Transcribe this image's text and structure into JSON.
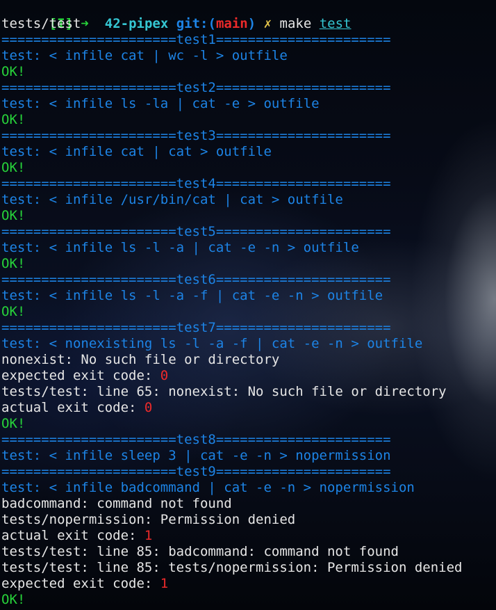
{
  "prompt": {
    "indicator": "[I]",
    "arrow": "➜",
    "directory": "42-pipex",
    "git_prefix": "git:(",
    "branch": "main",
    "git_suffix": ")",
    "dirty_mark": "✗",
    "command": "make",
    "target": "test"
  },
  "output": [
    {
      "text": "tests/test",
      "color": "white"
    },
    {
      "text": "======================test1======================",
      "color": "blue"
    },
    {
      "text": "test: < infile cat | wc -l > outfile",
      "color": "blue"
    },
    {
      "text": "OK!",
      "color": "green"
    },
    {
      "text": "======================test2======================",
      "color": "blue"
    },
    {
      "text": "test: < infile ls -la | cat -e > outfile",
      "color": "blue"
    },
    {
      "text": "OK!",
      "color": "green"
    },
    {
      "text": "======================test3======================",
      "color": "blue"
    },
    {
      "text": "test: < infile cat | cat > outfile",
      "color": "blue"
    },
    {
      "text": "OK!",
      "color": "green"
    },
    {
      "text": "======================test4======================",
      "color": "blue"
    },
    {
      "text": "test: < infile /usr/bin/cat | cat > outfile",
      "color": "blue"
    },
    {
      "text": "OK!",
      "color": "green"
    },
    {
      "text": "======================test5======================",
      "color": "blue"
    },
    {
      "text": "test: < infile ls -l -a | cat -e -n > outfile",
      "color": "blue"
    },
    {
      "text": "OK!",
      "color": "green"
    },
    {
      "text": "======================test6======================",
      "color": "blue"
    },
    {
      "text": "test: < infile ls -l -a -f | cat -e -n > outfile",
      "color": "blue"
    },
    {
      "text": "OK!",
      "color": "green"
    },
    {
      "text": "======================test7======================",
      "color": "blue"
    },
    {
      "text": "test: < nonexisting ls -l -a -f | cat -e -n > outfile",
      "color": "blue"
    },
    {
      "text": "nonexist: No such file or directory",
      "color": "white"
    },
    {
      "label": "expected exit code: ",
      "code": "0"
    },
    {
      "text": "tests/test: line 65: nonexist: No such file or directory",
      "color": "white"
    },
    {
      "label": "actual exit code: ",
      "code": "0"
    },
    {
      "text": "OK!",
      "color": "green"
    },
    {
      "text": "======================test8======================",
      "color": "blue"
    },
    {
      "text": "test: < infile sleep 3 | cat -e -n > nopermission",
      "color": "blue"
    },
    {
      "text": "======================test9======================",
      "color": "blue"
    },
    {
      "text": "test: < infile badcommand | cat -e -n > nopermission",
      "color": "blue"
    },
    {
      "text": "badcommand: command not found",
      "color": "white"
    },
    {
      "text": "tests/nopermission: Permission denied",
      "color": "white"
    },
    {
      "label": "actual exit code: ",
      "code": "1"
    },
    {
      "text": "tests/test: line 85: badcommand: command not found",
      "color": "white"
    },
    {
      "text": "tests/test: line 85: tests/nopermission: Permission denied",
      "color": "white"
    },
    {
      "label": "expected exit code: ",
      "code": "1"
    },
    {
      "text": "OK!",
      "color": "green"
    }
  ],
  "colors": {
    "text": "#e6e6e6",
    "blue": "#1d84e6",
    "green": "#27d23a",
    "red": "#ec2a2a",
    "cyan": "#35c6d2"
  }
}
